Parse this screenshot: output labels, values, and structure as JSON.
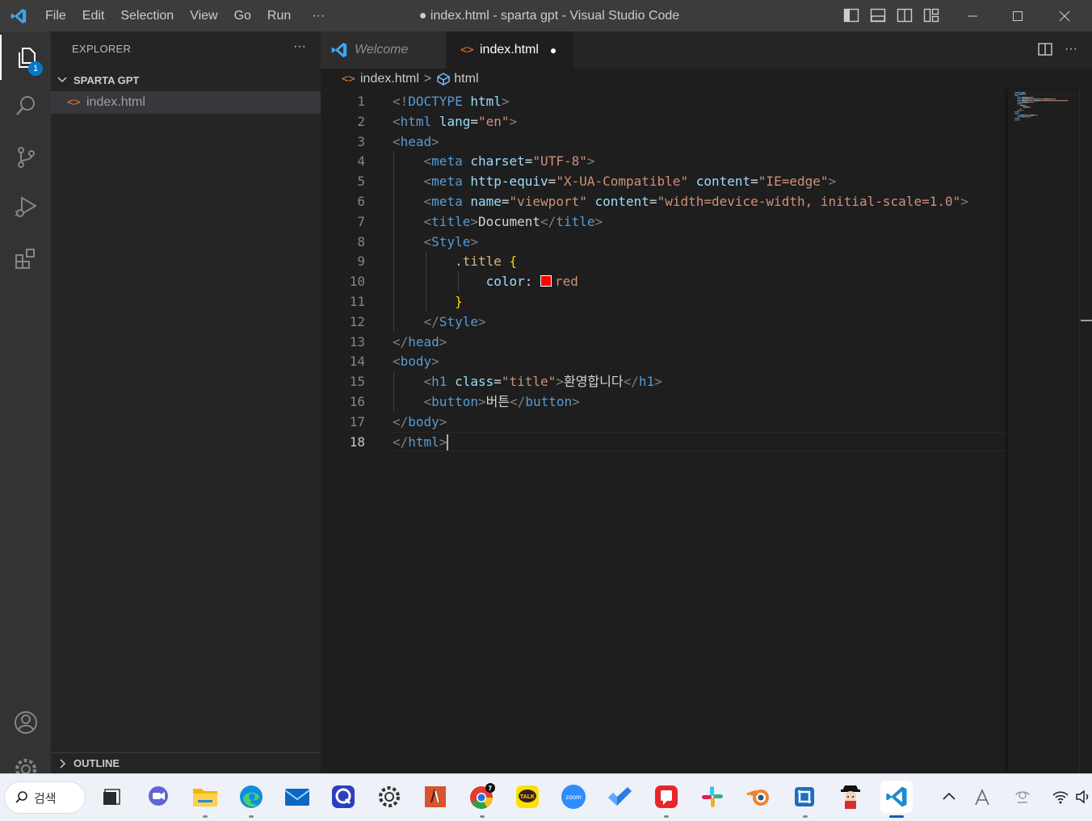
{
  "titlebar": {
    "logo_icon": "vscode-logo-icon",
    "menu": [
      "File",
      "Edit",
      "Selection",
      "View",
      "Go",
      "Run"
    ],
    "more": "···",
    "title": "● index.html - sparta gpt - Visual Studio Code"
  },
  "activity_bar": {
    "explorer_badge": "1"
  },
  "sidebar": {
    "header": "EXPLORER",
    "more": "···",
    "folder_name": "SPARTA GPT",
    "files": [
      "index.html"
    ],
    "outline": "OUTLINE"
  },
  "tabs": [
    {
      "label": "Welcome",
      "icon": "vscode-logo-icon"
    },
    {
      "label": "index.html",
      "icon": "html-file-icon",
      "modified_dot": "●"
    }
  ],
  "breadcrumb": {
    "file": "index.html",
    "separator": ">",
    "element": "html"
  },
  "code": {
    "line_numbers": [
      "1",
      "2",
      "3",
      "4",
      "5",
      "6",
      "7",
      "8",
      "9",
      "10",
      "11",
      "12",
      "13",
      "14",
      "15",
      "16",
      "17",
      "18"
    ],
    "current_line": 18,
    "css_color_swatch": "#ff0000",
    "lines": [
      [
        [
          "t-br",
          "<!"
        ],
        [
          "t-tag",
          "DOCTYPE"
        ],
        [
          "t-txt",
          " "
        ],
        [
          "t-attr",
          "html"
        ],
        [
          "t-br",
          ">"
        ]
      ],
      [
        [
          "t-br",
          "<"
        ],
        [
          "t-tag",
          "html"
        ],
        [
          "t-txt",
          " "
        ],
        [
          "t-attr",
          "lang"
        ],
        [
          "t-txt",
          "="
        ],
        [
          "t-str",
          "\"en\""
        ],
        [
          "t-br",
          ">"
        ]
      ],
      [
        [
          "t-br",
          "<"
        ],
        [
          "t-tag",
          "head"
        ],
        [
          "t-br",
          ">"
        ]
      ],
      [
        [
          "t-txt",
          "    "
        ],
        [
          "t-br",
          "<"
        ],
        [
          "t-tag",
          "meta"
        ],
        [
          "t-txt",
          " "
        ],
        [
          "t-attr",
          "charset"
        ],
        [
          "t-txt",
          "="
        ],
        [
          "t-str",
          "\"UTF-8\""
        ],
        [
          "t-br",
          ">"
        ]
      ],
      [
        [
          "t-txt",
          "    "
        ],
        [
          "t-br",
          "<"
        ],
        [
          "t-tag",
          "meta"
        ],
        [
          "t-txt",
          " "
        ],
        [
          "t-attr",
          "http-equiv"
        ],
        [
          "t-txt",
          "="
        ],
        [
          "t-str",
          "\"X-UA-Compatible\""
        ],
        [
          "t-txt",
          " "
        ],
        [
          "t-attr",
          "content"
        ],
        [
          "t-txt",
          "="
        ],
        [
          "t-str",
          "\"IE=edge\""
        ],
        [
          "t-br",
          ">"
        ]
      ],
      [
        [
          "t-txt",
          "    "
        ],
        [
          "t-br",
          "<"
        ],
        [
          "t-tag",
          "meta"
        ],
        [
          "t-txt",
          " "
        ],
        [
          "t-attr",
          "name"
        ],
        [
          "t-txt",
          "="
        ],
        [
          "t-str",
          "\"viewport\""
        ],
        [
          "t-txt",
          " "
        ],
        [
          "t-attr",
          "content"
        ],
        [
          "t-txt",
          "="
        ],
        [
          "t-str",
          "\"width=device-width, initial-scale=1.0\""
        ],
        [
          "t-br",
          ">"
        ]
      ],
      [
        [
          "t-txt",
          "    "
        ],
        [
          "t-br",
          "<"
        ],
        [
          "t-tag",
          "title"
        ],
        [
          "t-br",
          ">"
        ],
        [
          "t-txt",
          "Document"
        ],
        [
          "t-br",
          "</"
        ],
        [
          "t-tag",
          "title"
        ],
        [
          "t-br",
          ">"
        ]
      ],
      [
        [
          "t-txt",
          "    "
        ],
        [
          "t-br",
          "<"
        ],
        [
          "t-tag",
          "Style"
        ],
        [
          "t-br",
          ">"
        ]
      ],
      [
        [
          "t-txt",
          "        "
        ],
        [
          "t-sel",
          ".title"
        ],
        [
          "t-txt",
          " "
        ],
        [
          "t-brace",
          "{"
        ]
      ],
      [
        [
          "t-txt",
          "            "
        ],
        [
          "t-prop",
          "color"
        ],
        [
          "t-txt",
          ": "
        ],
        [
          "swatch",
          ""
        ],
        [
          "t-str",
          "red"
        ]
      ],
      [
        [
          "t-txt",
          "        "
        ],
        [
          "t-brace",
          "}"
        ]
      ],
      [
        [
          "t-txt",
          "    "
        ],
        [
          "t-br",
          "</"
        ],
        [
          "t-tag",
          "Style"
        ],
        [
          "t-br",
          ">"
        ]
      ],
      [
        [
          "t-br",
          "</"
        ],
        [
          "t-tag",
          "head"
        ],
        [
          "t-br",
          ">"
        ]
      ],
      [
        [
          "t-br",
          "<"
        ],
        [
          "t-tag",
          "body"
        ],
        [
          "t-br",
          ">"
        ]
      ],
      [
        [
          "t-txt",
          "    "
        ],
        [
          "t-br",
          "<"
        ],
        [
          "t-tag",
          "h1"
        ],
        [
          "t-txt",
          " "
        ],
        [
          "t-attr",
          "class"
        ],
        [
          "t-txt",
          "="
        ],
        [
          "t-str",
          "\"title\""
        ],
        [
          "t-br",
          ">"
        ],
        [
          "t-txt",
          "환영합니다"
        ],
        [
          "t-br",
          "</"
        ],
        [
          "t-tag",
          "h1"
        ],
        [
          "t-br",
          ">"
        ]
      ],
      [
        [
          "t-txt",
          "    "
        ],
        [
          "t-br",
          "<"
        ],
        [
          "t-tag",
          "button"
        ],
        [
          "t-br",
          ">"
        ],
        [
          "t-txt",
          "버튼"
        ],
        [
          "t-br",
          "</"
        ],
        [
          "t-tag",
          "button"
        ],
        [
          "t-br",
          ">"
        ]
      ],
      [
        [
          "t-br",
          "</"
        ],
        [
          "t-tag",
          "body"
        ],
        [
          "t-br",
          ">"
        ]
      ],
      [
        [
          "t-br",
          "</"
        ],
        [
          "t-tag",
          "html"
        ],
        [
          "t-br",
          ">"
        ],
        [
          "caret",
          ""
        ]
      ]
    ]
  },
  "taskbar": {
    "search_label": "검색",
    "apps": [
      {
        "name": "task-view",
        "icon": "task-view-icon",
        "active": false,
        "running": false
      },
      {
        "name": "teams-chat",
        "icon": "chat-icon",
        "active": false,
        "running": false
      },
      {
        "name": "file-explorer",
        "icon": "folder-icon",
        "active": false,
        "running": true
      },
      {
        "name": "edge",
        "icon": "edge-icon",
        "active": false,
        "running": true
      },
      {
        "name": "mail",
        "icon": "mail-icon",
        "active": false,
        "running": false
      },
      {
        "name": "app-q",
        "icon": "q-app-icon",
        "active": false,
        "running": false
      },
      {
        "name": "settings",
        "icon": "gear-icon",
        "active": false,
        "running": false
      },
      {
        "name": "office",
        "icon": "office-icon",
        "active": false,
        "running": false
      },
      {
        "name": "chrome",
        "icon": "chrome-icon",
        "active": false,
        "running": true
      },
      {
        "name": "kakaotalk",
        "icon": "talk-icon",
        "active": false,
        "running": false
      },
      {
        "name": "zoom",
        "icon": "zoom-icon",
        "active": false,
        "running": false
      },
      {
        "name": "todo",
        "icon": "check-icon",
        "active": false,
        "running": false
      },
      {
        "name": "red-app",
        "icon": "red-app-icon",
        "active": false,
        "running": true
      },
      {
        "name": "slack",
        "icon": "slack-icon",
        "active": false,
        "running": false
      },
      {
        "name": "blender",
        "icon": "blender-icon",
        "active": false,
        "running": false
      },
      {
        "name": "snip",
        "icon": "snip-icon",
        "active": false,
        "running": true
      },
      {
        "name": "character-app",
        "icon": "character-icon",
        "active": false,
        "running": false
      },
      {
        "name": "vscode",
        "icon": "vscode-logo-icon",
        "active": true,
        "running": true
      }
    ],
    "tray_talk_label": "TALK",
    "tray_zoom_label": "zoom"
  }
}
